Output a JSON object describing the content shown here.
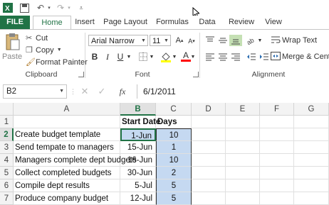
{
  "qat": {
    "undo_icon": "undo-icon",
    "redo_icon": "redo-icon",
    "save_icon": "save-icon",
    "customize_icon": "customize-icon"
  },
  "tabs": [
    "FILE",
    "Home",
    "Insert",
    "Page Layout",
    "Formulas",
    "Data",
    "Review",
    "View"
  ],
  "ribbon": {
    "clipboard": {
      "paste": "Paste",
      "cut": "Cut",
      "copy": "Copy",
      "format_painter": "Format Painter",
      "label": "Clipboard"
    },
    "font": {
      "name": "Arial Narrow",
      "size": "11",
      "label": "Font",
      "bold": "B",
      "italic": "I",
      "underline": "U"
    },
    "alignment": {
      "wrap_text": "Wrap Text",
      "merge": "Merge & Cente",
      "label": "Alignment"
    }
  },
  "formula_bar": {
    "name_box": "B2",
    "formula": "6/1/2011",
    "fx": "fx"
  },
  "columns": [
    "A",
    "B",
    "C",
    "D",
    "E",
    "F",
    "G"
  ],
  "rows": [
    {
      "n": "1",
      "a": "",
      "b": "Start Date",
      "c": "Days"
    },
    {
      "n": "2",
      "a": "Create budget template",
      "b": "1-Jun",
      "c": "10"
    },
    {
      "n": "3",
      "a": "Send tempate to managers",
      "b": "15-Jun",
      "c": "1"
    },
    {
      "n": "4",
      "a": "Managers complete dept budgets",
      "b": "16-Jun",
      "c": "10"
    },
    {
      "n": "5",
      "a": "Collect completed budgets",
      "b": "30-Jun",
      "c": "2"
    },
    {
      "n": "6",
      "a": "Compile dept results",
      "b": "5-Jul",
      "c": "5"
    },
    {
      "n": "7",
      "a": "Produce company budget",
      "b": "12-Jul",
      "c": "5"
    }
  ],
  "colors": {
    "accent": "#217346",
    "selected_fill": "#c5d9f1"
  }
}
